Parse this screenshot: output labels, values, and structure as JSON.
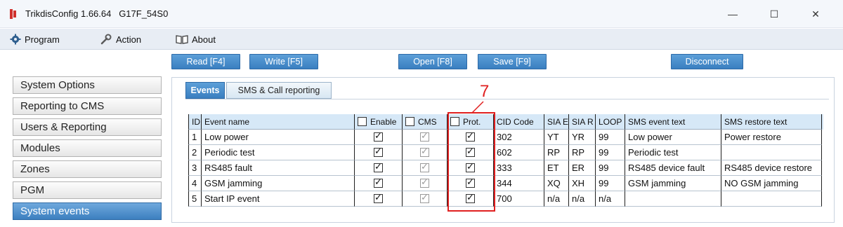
{
  "window": {
    "title": "TrikdisConfig 1.66.64   G17F_54S0",
    "controls": {
      "minimize": "—",
      "maximize": "☐",
      "close": "✕"
    }
  },
  "menu": {
    "program": "Program",
    "action": "Action",
    "about": "About"
  },
  "toolbar": {
    "read": "Read [F4]",
    "write": "Write [F5]",
    "open": "Open [F8]",
    "save": "Save [F9]",
    "disconnect": "Disconnect"
  },
  "sidebar": {
    "items": [
      {
        "label": "System Options"
      },
      {
        "label": "Reporting to CMS"
      },
      {
        "label": "Users & Reporting"
      },
      {
        "label": "Modules"
      },
      {
        "label": "Zones"
      },
      {
        "label": "PGM"
      },
      {
        "label": "System events",
        "active": true
      }
    ]
  },
  "tabs": [
    {
      "label": "Events",
      "active": true
    },
    {
      "label": "SMS & Call reporting"
    }
  ],
  "annotation": {
    "label": "7",
    "color": "#e02020"
  },
  "table": {
    "headers": {
      "id": "ID",
      "event_name": "Event name",
      "enable": "Enable",
      "cms": "CMS",
      "prot": "Prot.",
      "cid_code": "CID Code",
      "sia_e": "SIA E",
      "sia_r": "SIA R",
      "loop": "LOOP",
      "sms_event_text": "SMS event text",
      "sms_restore_text": "SMS restore text"
    },
    "rows": [
      {
        "id": "1",
        "event_name": "Low power",
        "enable": true,
        "cms": true,
        "prot": true,
        "cid_code": "302",
        "sia_e": "YT",
        "sia_r": "YR",
        "loop": "99",
        "sms_event_text": "Low power",
        "sms_restore_text": "Power restore"
      },
      {
        "id": "2",
        "event_name": "Periodic test",
        "enable": true,
        "cms": true,
        "prot": true,
        "cid_code": "602",
        "sia_e": "RP",
        "sia_r": "RP",
        "loop": "99",
        "sms_event_text": "Periodic test",
        "sms_restore_text": ""
      },
      {
        "id": "3",
        "event_name": "RS485 fault",
        "enable": true,
        "cms": true,
        "prot": true,
        "cid_code": "333",
        "sia_e": "ET",
        "sia_r": "ER",
        "loop": "99",
        "sms_event_text": "RS485 device fault",
        "sms_restore_text": "RS485 device restore"
      },
      {
        "id": "4",
        "event_name": "GSM jamming",
        "enable": true,
        "cms": true,
        "prot": true,
        "cid_code": "344",
        "sia_e": "XQ",
        "sia_r": "XH",
        "loop": "99",
        "sms_event_text": "GSM jamming",
        "sms_restore_text": "NO GSM jamming"
      },
      {
        "id": "5",
        "event_name": "Start IP event",
        "enable": true,
        "cms": true,
        "prot": true,
        "cid_code": "700",
        "sia_e": "n/a",
        "sia_r": "n/a",
        "loop": "n/a",
        "sms_event_text": "",
        "sms_restore_text": ""
      }
    ]
  },
  "colors": {
    "accent": "#3a7fc0",
    "header_row": "#d6e8f7",
    "annotation": "#e02020"
  }
}
